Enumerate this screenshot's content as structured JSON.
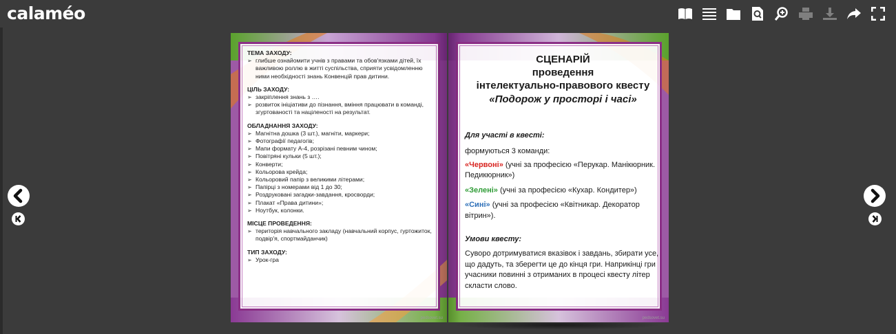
{
  "app": {
    "logo": "calaméo"
  },
  "toolbar": {
    "items": [
      {
        "name": "book-view-icon",
        "enabled": true
      },
      {
        "name": "list-icon",
        "enabled": true
      },
      {
        "name": "fullscreen-page-icon",
        "enabled": true
      },
      {
        "name": "search-doc-icon",
        "enabled": true
      },
      {
        "name": "zoom-icon",
        "enabled": true
      },
      {
        "name": "print-icon",
        "enabled": false
      },
      {
        "name": "download-icon",
        "enabled": false
      },
      {
        "name": "share-icon",
        "enabled": true
      },
      {
        "name": "expand-icon",
        "enabled": true
      }
    ]
  },
  "nav": {
    "prev": "previous-page",
    "first": "first-page",
    "next": "next-page",
    "last": "last-page"
  },
  "left_page": {
    "sections": [
      {
        "heading": "ТЕМА ЗАХОДУ:",
        "items": [
          "глибше ознайомити учнів з правами та обов'язками дітей, їх важливою роллю в житті суспільства, сприяти усвідомленню ними необхідності знань Конвенцій прав дитини."
        ]
      },
      {
        "heading": "ЦІЛЬ ЗАХОДУ:",
        "items": [
          "закріплення знань з ….",
          "розвиток ініціативи до пізнання, вміння працювати в команді, згуртованості та націленості на результат."
        ]
      },
      {
        "heading": "ОБЛАДНАННЯ ЗАХОДУ:",
        "items": [
          "Магнітна дошка (3 шт.), магніти, маркери;",
          "Фотографії педагогів;",
          "Мапи формату А-4, розрізані певним чином;",
          "Повітряні кульки (5 шт.);",
          "Конверти;",
          "Кольорова крейда;",
          "Кольоровий папір з великими літерами;",
          "Папірці з номерами від 1 до 30;",
          "Роздруковані загадки-завдання, кросворди;",
          "Плакат «Права дитини»;",
          "Ноутбук, колонки."
        ]
      },
      {
        "heading": "МІСЦЕ ПРОВЕДЕННЯ:",
        "items": [
          "територія навчального закладу (навчальний корпус, гуртожиток, подвір'я, спортмайданчик)"
        ]
      },
      {
        "heading": "ТИП ЗАХОДУ:",
        "items": [
          "Урок-гра"
        ]
      }
    ],
    "watermark": "pedsovet.su"
  },
  "right_page": {
    "title1": "СЦЕНАРІЙ",
    "title2": "проведення",
    "title3": "інтелектуально-правового квесту",
    "title4": "«Подорож у просторі і часі»",
    "subhead1": "Для участі в квесті:",
    "intro": "формуються 3 команди:",
    "team1_name": "«Червоні»",
    "team1_desc": " (учні за професією «Перукар. Манікюрник. Педикюрник»)",
    "team2_name": "«Зелені»",
    "team2_desc": " (учні за професією «Кухар. Кондитер»)",
    "team3_name": "«Сині»",
    "team3_desc": " (учні за професією «Квітникар. Декоратор вітрин»).",
    "subhead2": "Умови квесту:",
    "conditions": "Суворо дотримуватися вказівок і завдань, збирати усе, що дадуть, та зберегти це до кінця гри. Наприкінці гри учасники повинні з отриманих в процесі квесту літер скласти слово.",
    "watermark": "pedsovet.su"
  },
  "colors": {
    "background": "#3b3b3b",
    "frame": "#8b2f86",
    "red_team": "#d8231f",
    "green_team": "#2e9b35",
    "blue_team": "#2d6fb8"
  }
}
